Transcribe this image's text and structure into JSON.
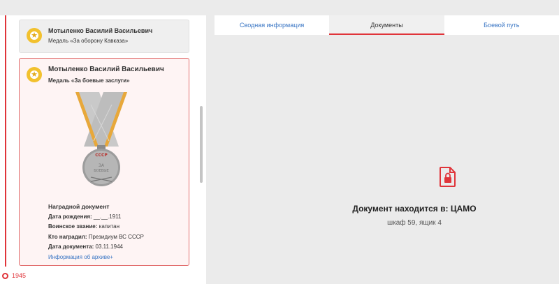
{
  "timeline": {
    "year": "1945"
  },
  "cards": [
    {
      "name": "Мотыленко Василий Васильевич",
      "award": "Медаль «За оборону Кавказа»"
    },
    {
      "name": "Мотыленко Василий Васильевич",
      "award": "Медаль «За боевые заслуги»"
    }
  ],
  "document": {
    "heading": "Наградной документ",
    "birth_label": "Дата рождения:",
    "birth_value": "__.__.1911",
    "rank_label": "Воинское звание:",
    "rank_value": "капитан",
    "awarder_label": "Кто наградил:",
    "awarder_value": "Президиум ВС СССР",
    "date_label": "Дата документа:",
    "date_value": "03.11.1944",
    "archive_link": "Информация об архиве+"
  },
  "tabs": [
    {
      "label": "Сводная информация"
    },
    {
      "label": "Документы"
    },
    {
      "label": "Боевой путь"
    }
  ],
  "active_tab": "Документы",
  "location": {
    "title": "Документ находится в: ЦАМО",
    "subtitle": "шкаф 59, ящик 4"
  },
  "colors": {
    "accent": "#e0343a",
    "link": "#3a76c4",
    "medal_gold": "#f2c12e"
  },
  "icons": [
    "medal-icon",
    "lock-file-icon",
    "timeline-dot-icon"
  ]
}
